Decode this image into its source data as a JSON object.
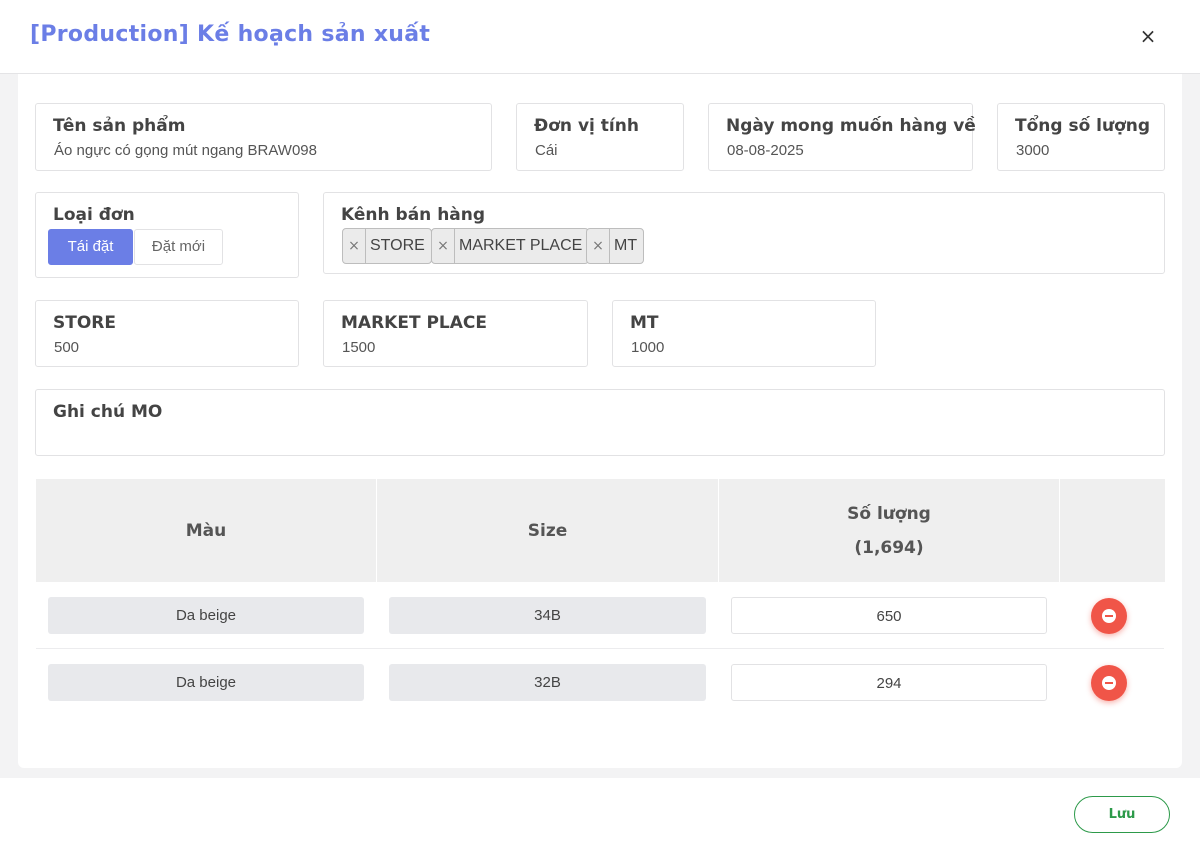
{
  "modal": {
    "title": "[Production] Kế hoạch sản xuất",
    "close_icon": "×"
  },
  "fields": {
    "product_name": {
      "label": "Tên sản phẩm",
      "value": "Áo ngực có gọng mút ngang BRAW098"
    },
    "unit": {
      "label": "Đơn vị tính",
      "value": "Cái"
    },
    "expected_date": {
      "label": "Ngày mong muốn hàng về",
      "value": "08-08-2025"
    },
    "total_qty": {
      "label": "Tổng số lượng",
      "value": "3000"
    },
    "order_type": {
      "label": "Loại đơn",
      "options": [
        "Tái đặt",
        "Đặt mới"
      ],
      "selected": "Tái đặt"
    },
    "sales_channel": {
      "label": "Kênh bán hàng",
      "tags": [
        "STORE",
        "MARKET PLACE",
        "MT"
      ],
      "remove_icon": "×"
    },
    "channel_qty": [
      {
        "label": "STORE",
        "value": "500"
      },
      {
        "label": "MARKET PLACE",
        "value": "1500"
      },
      {
        "label": "MT",
        "value": "1000"
      }
    ],
    "note": {
      "label": "Ghi chú MO",
      "value": ""
    }
  },
  "table": {
    "headers": {
      "color": "Màu",
      "size": "Size",
      "qty": "Số lượng",
      "qty_total": "(1,694)"
    },
    "rows": [
      {
        "color": "Da beige",
        "size": "34B",
        "qty": "650"
      },
      {
        "color": "Da beige",
        "size": "32B",
        "qty": "294"
      }
    ]
  },
  "footer": {
    "save_label": "Lưu"
  },
  "colors": {
    "accent": "#6b7ee6",
    "danger": "#f05548",
    "success": "#2d9a4a"
  }
}
